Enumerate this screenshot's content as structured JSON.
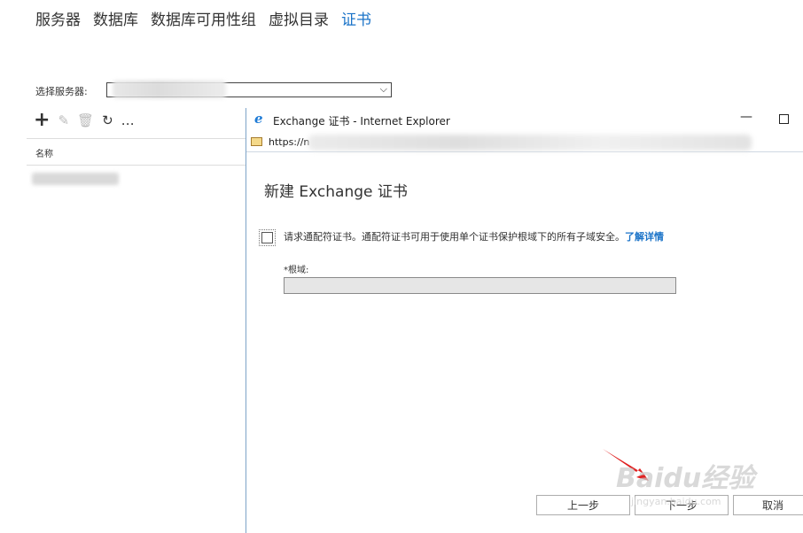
{
  "topnav": {
    "tabs": [
      {
        "label": "服务器"
      },
      {
        "label": "数据库"
      },
      {
        "label": "数据库可用性组"
      },
      {
        "label": "虚拟目录"
      },
      {
        "label": "证书"
      }
    ],
    "active_index": 4
  },
  "server_select": {
    "label": "选择服务器:"
  },
  "toolbar": {
    "add_icon": "plus-icon",
    "edit_icon": "pencil-icon",
    "delete_icon": "trash-icon",
    "refresh_icon": "refresh-icon",
    "more_icon": "ellipsis-icon"
  },
  "list": {
    "column_name": "名称"
  },
  "popup": {
    "window_title": "Exchange 证书 - Internet Explorer",
    "url": "https://n",
    "dialog_title": "新建 Exchange 证书",
    "wildcard_text": "请求通配符证书。通配符证书可用于使用单个证书保护根域下的所有子域安全。",
    "learn_more": "了解详情",
    "root_domain_label": "*根域:",
    "root_domain_value": "",
    "buttons": {
      "prev": "上一步",
      "next": "下一步",
      "cancel": "取消"
    }
  },
  "watermark": {
    "brand": "Baidu经验",
    "url": "jingyan.baidu.com"
  },
  "colors": {
    "accent": "#1a73c8",
    "arrow": "#e02020"
  }
}
